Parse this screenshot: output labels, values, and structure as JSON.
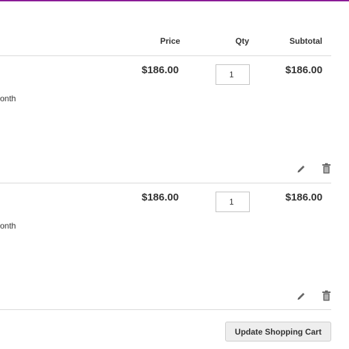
{
  "header": {
    "price": "Price",
    "qty": "Qty",
    "subtotal": "Subtotal"
  },
  "items": [
    {
      "price": "$186.00",
      "qty": "1",
      "subtotal": "$186.00",
      "option_fragment": "onth"
    },
    {
      "price": "$186.00",
      "qty": "1",
      "subtotal": "$186.00",
      "option_fragment": "onth"
    }
  ],
  "actions": {
    "update_cart": "Update Shopping Cart"
  },
  "icons": {
    "edit": "pencil-icon",
    "delete": "trash-icon"
  },
  "colors": {
    "accent_bar": "#8a1b96",
    "text": "#333333",
    "divider": "#d9d9d9",
    "button_bg": "#eeeeee"
  }
}
